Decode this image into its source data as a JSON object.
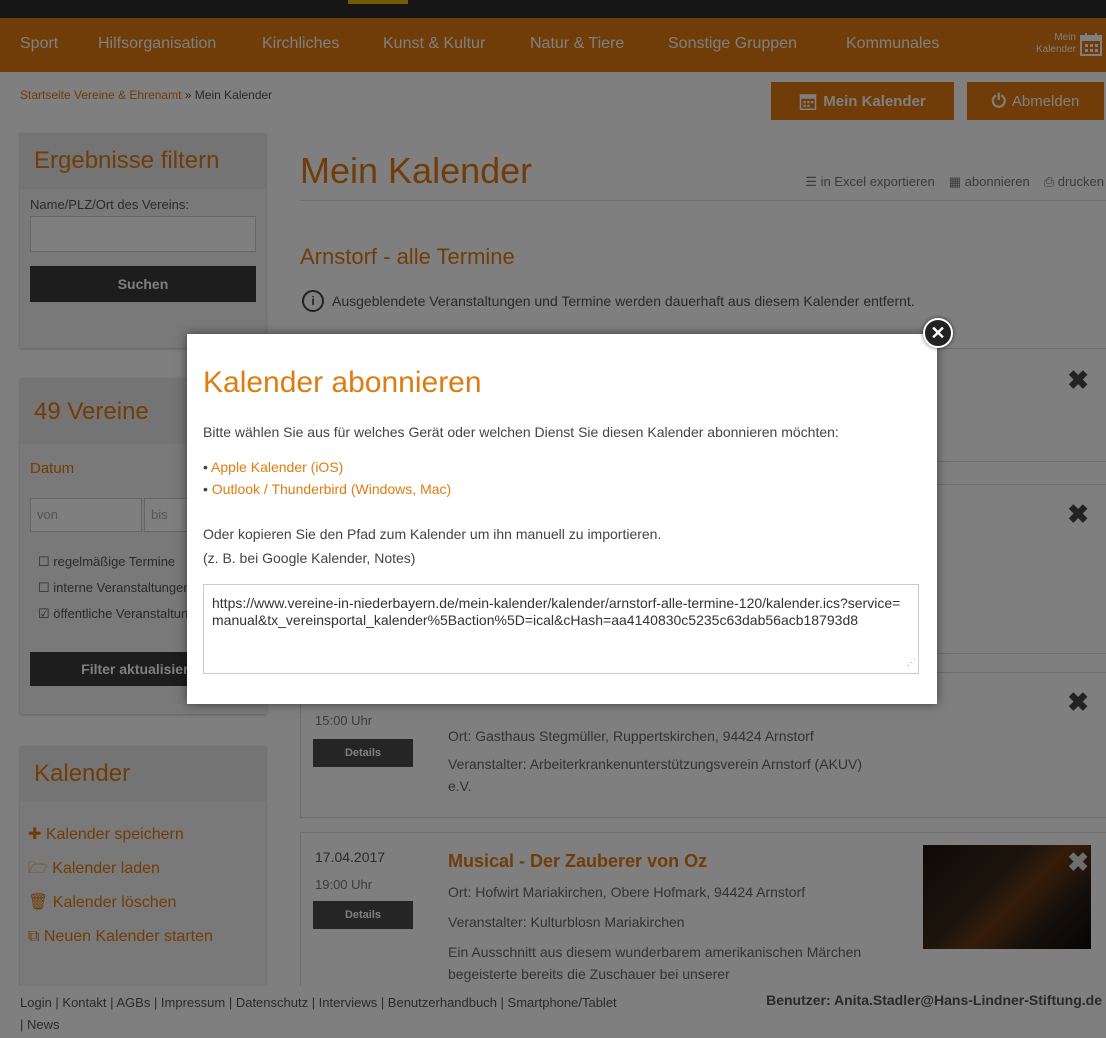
{
  "nav": {
    "items": [
      "Sport",
      "Hilfsorganisation",
      "Kirchliches",
      "Kunst & Kultur",
      "Natur & Tiere",
      "Sonstige Gruppen",
      "Kommunales"
    ],
    "my_calendar_line1": "Mein",
    "my_calendar_line2": "Kalender"
  },
  "breadcrumb": {
    "home": "Startseite Vereine & Ehrenamt",
    "sep": "»",
    "current": "Mein Kalender"
  },
  "buttons": {
    "my_calendar": "Mein Kalender",
    "logout": "Abmelden"
  },
  "filter": {
    "title": "Ergebnisse filtern",
    "name_label": "Name/PLZ/Ort des Vereins:",
    "search_btn": "Suchen"
  },
  "vereine": {
    "title": "49 Vereine",
    "date_label": "Datum",
    "from_placeholder": "von",
    "to_placeholder": "bis",
    "checkboxes": [
      {
        "label": "regelmäßige Termine",
        "checked": false
      },
      {
        "label": "interne Veranstaltungen",
        "checked": false
      },
      {
        "label": "öffentliche Veranstaltungen",
        "checked": true
      }
    ],
    "update_btn": "Filter aktualisieren"
  },
  "kalender_box": {
    "title": "Kalender",
    "actions": [
      "Kalender speichern",
      "Kalender laden",
      "Kalender löschen",
      "Neuen Kalender starten"
    ]
  },
  "main": {
    "title": "Mein Kalender",
    "tools": [
      "in Excel exportieren",
      "abonnieren",
      "drucken"
    ],
    "subtitle": "Arnstorf - alle Termine",
    "info": "Ausgeblendete Veranstaltungen und Termine werden dauerhaft aus diesem Kalender entfernt."
  },
  "events": [
    {
      "time": "15:00 Uhr",
      "details": "Details",
      "location": "Ort: Gasthaus Stegmüller, Ruppertskirchen, 94424 Arnstorf",
      "organizer": "Veranstalter: Arbeiterkrankenunterstützungsverein Arnstorf (AKUV) e.V."
    },
    {
      "date": "17.04.2017",
      "time": "19:00 Uhr",
      "details": "Details",
      "title": "Musical - Der Zauberer von Oz",
      "location": "Ort: Hofwirt Mariakirchen, Obere Hofmark, 94424 Arnstorf",
      "organizer": "Veranstalter: Kulturblosn Mariakirchen",
      "description": "Ein Ausschnitt aus diesem wunderbarem amerikanischen Märchen begeisterte bereits die Zuschauer bei unserer"
    }
  ],
  "footer": {
    "links": "Login | Kontakt | AGBs | Impressum | Datenschutz | Interviews | Benutzerhandbuch | Smartphone/Tablet | News",
    "user": "Benutzer: Anita.Stadler@Hans-Lindner-Stiftung.de"
  },
  "modal": {
    "title": "Kalender abonnieren",
    "intro": "Bitte wählen Sie aus für welches Gerät oder welchen Dienst Sie diesen Kalender abonnieren möchten:",
    "options": [
      "Apple Kalender (iOS)",
      "Outlook / Thunderbird (Windows, Mac)"
    ],
    "copy_text": "Oder kopieren Sie den Pfad zum Kalender um ihn manuell zu importieren.",
    "copy_hint": "(z. B. bei Google Kalender, Notes)",
    "url": "https://www.vereine-in-niederbayern.de/mein-kalender/kalender/arnstorf-alle-termine-120/kalender.ics?service=manual&tx_vereinsportal_kalender%5Baction%5D=ical&cHash=aa4140830c5235c63dab56acb18793d8"
  },
  "colors": {
    "accent": "#e07b10",
    "dark": "#3a3a3a"
  }
}
